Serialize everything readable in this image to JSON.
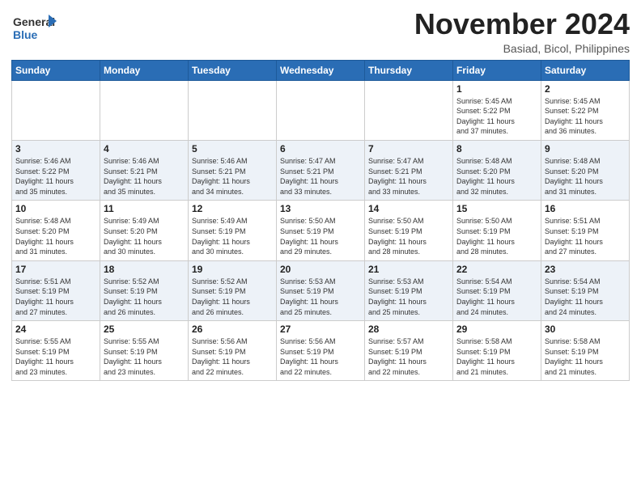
{
  "header": {
    "logo_general": "General",
    "logo_blue": "Blue",
    "month_title": "November 2024",
    "location": "Basiad, Bicol, Philippines"
  },
  "calendar": {
    "days_of_week": [
      "Sunday",
      "Monday",
      "Tuesday",
      "Wednesday",
      "Thursday",
      "Friday",
      "Saturday"
    ],
    "weeks": [
      [
        {
          "day": "",
          "info": ""
        },
        {
          "day": "",
          "info": ""
        },
        {
          "day": "",
          "info": ""
        },
        {
          "day": "",
          "info": ""
        },
        {
          "day": "",
          "info": ""
        },
        {
          "day": "1",
          "info": "Sunrise: 5:45 AM\nSunset: 5:22 PM\nDaylight: 11 hours\nand 37 minutes."
        },
        {
          "day": "2",
          "info": "Sunrise: 5:45 AM\nSunset: 5:22 PM\nDaylight: 11 hours\nand 36 minutes."
        }
      ],
      [
        {
          "day": "3",
          "info": "Sunrise: 5:46 AM\nSunset: 5:22 PM\nDaylight: 11 hours\nand 35 minutes."
        },
        {
          "day": "4",
          "info": "Sunrise: 5:46 AM\nSunset: 5:21 PM\nDaylight: 11 hours\nand 35 minutes."
        },
        {
          "day": "5",
          "info": "Sunrise: 5:46 AM\nSunset: 5:21 PM\nDaylight: 11 hours\nand 34 minutes."
        },
        {
          "day": "6",
          "info": "Sunrise: 5:47 AM\nSunset: 5:21 PM\nDaylight: 11 hours\nand 33 minutes."
        },
        {
          "day": "7",
          "info": "Sunrise: 5:47 AM\nSunset: 5:21 PM\nDaylight: 11 hours\nand 33 minutes."
        },
        {
          "day": "8",
          "info": "Sunrise: 5:48 AM\nSunset: 5:20 PM\nDaylight: 11 hours\nand 32 minutes."
        },
        {
          "day": "9",
          "info": "Sunrise: 5:48 AM\nSunset: 5:20 PM\nDaylight: 11 hours\nand 31 minutes."
        }
      ],
      [
        {
          "day": "10",
          "info": "Sunrise: 5:48 AM\nSunset: 5:20 PM\nDaylight: 11 hours\nand 31 minutes."
        },
        {
          "day": "11",
          "info": "Sunrise: 5:49 AM\nSunset: 5:20 PM\nDaylight: 11 hours\nand 30 minutes."
        },
        {
          "day": "12",
          "info": "Sunrise: 5:49 AM\nSunset: 5:19 PM\nDaylight: 11 hours\nand 30 minutes."
        },
        {
          "day": "13",
          "info": "Sunrise: 5:50 AM\nSunset: 5:19 PM\nDaylight: 11 hours\nand 29 minutes."
        },
        {
          "day": "14",
          "info": "Sunrise: 5:50 AM\nSunset: 5:19 PM\nDaylight: 11 hours\nand 28 minutes."
        },
        {
          "day": "15",
          "info": "Sunrise: 5:50 AM\nSunset: 5:19 PM\nDaylight: 11 hours\nand 28 minutes."
        },
        {
          "day": "16",
          "info": "Sunrise: 5:51 AM\nSunset: 5:19 PM\nDaylight: 11 hours\nand 27 minutes."
        }
      ],
      [
        {
          "day": "17",
          "info": "Sunrise: 5:51 AM\nSunset: 5:19 PM\nDaylight: 11 hours\nand 27 minutes."
        },
        {
          "day": "18",
          "info": "Sunrise: 5:52 AM\nSunset: 5:19 PM\nDaylight: 11 hours\nand 26 minutes."
        },
        {
          "day": "19",
          "info": "Sunrise: 5:52 AM\nSunset: 5:19 PM\nDaylight: 11 hours\nand 26 minutes."
        },
        {
          "day": "20",
          "info": "Sunrise: 5:53 AM\nSunset: 5:19 PM\nDaylight: 11 hours\nand 25 minutes."
        },
        {
          "day": "21",
          "info": "Sunrise: 5:53 AM\nSunset: 5:19 PM\nDaylight: 11 hours\nand 25 minutes."
        },
        {
          "day": "22",
          "info": "Sunrise: 5:54 AM\nSunset: 5:19 PM\nDaylight: 11 hours\nand 24 minutes."
        },
        {
          "day": "23",
          "info": "Sunrise: 5:54 AM\nSunset: 5:19 PM\nDaylight: 11 hours\nand 24 minutes."
        }
      ],
      [
        {
          "day": "24",
          "info": "Sunrise: 5:55 AM\nSunset: 5:19 PM\nDaylight: 11 hours\nand 23 minutes."
        },
        {
          "day": "25",
          "info": "Sunrise: 5:55 AM\nSunset: 5:19 PM\nDaylight: 11 hours\nand 23 minutes."
        },
        {
          "day": "26",
          "info": "Sunrise: 5:56 AM\nSunset: 5:19 PM\nDaylight: 11 hours\nand 22 minutes."
        },
        {
          "day": "27",
          "info": "Sunrise: 5:56 AM\nSunset: 5:19 PM\nDaylight: 11 hours\nand 22 minutes."
        },
        {
          "day": "28",
          "info": "Sunrise: 5:57 AM\nSunset: 5:19 PM\nDaylight: 11 hours\nand 22 minutes."
        },
        {
          "day": "29",
          "info": "Sunrise: 5:58 AM\nSunset: 5:19 PM\nDaylight: 11 hours\nand 21 minutes."
        },
        {
          "day": "30",
          "info": "Sunrise: 5:58 AM\nSunset: 5:19 PM\nDaylight: 11 hours\nand 21 minutes."
        }
      ]
    ]
  }
}
